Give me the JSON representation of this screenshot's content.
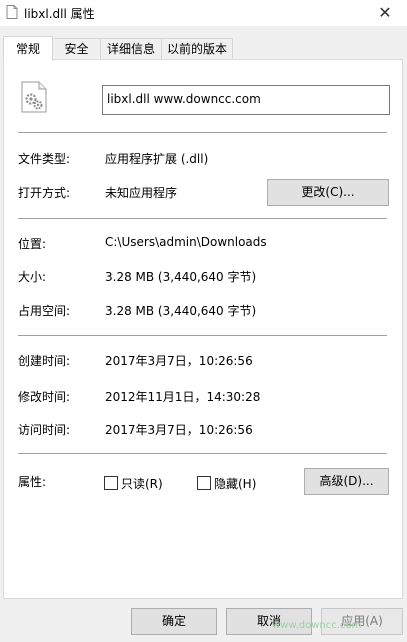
{
  "window": {
    "title": "libxl.dll 属性",
    "close_glyph": "✕"
  },
  "tabs": [
    {
      "label": "常规",
      "active": true
    },
    {
      "label": "安全"
    },
    {
      "label": "详细信息"
    },
    {
      "label": "以前的版本"
    }
  ],
  "file": {
    "name_field": "libxl.dll    www.downcc.com"
  },
  "general": {
    "type_label": "文件类型:",
    "type_value": "应用程序扩展 (.dll)",
    "open_label": "打开方式:",
    "open_value": "未知应用程序",
    "change_button": "更改(C)...",
    "location_label": "位置:",
    "location_value": "C:\\Users\\admin\\Downloads",
    "size_label": "大小:",
    "size_value": "3.28 MB (3,440,640 字节)",
    "disk_label": "占用空间:",
    "disk_value": "3.28 MB (3,440,640 字节)",
    "created_label": "创建时间:",
    "created_value": "2017年3月7日，10:26:56",
    "modified_label": "修改时间:",
    "modified_value": "2012年11月1日，14:30:28",
    "accessed_label": "访问时间:",
    "accessed_value": "2017年3月7日，10:26:56",
    "attrs_label": "属性:",
    "readonly_label": "只读(R)",
    "hidden_label": "隐藏(H)",
    "advanced_button": "高级(D)..."
  },
  "footer": {
    "ok": "确定",
    "cancel": "取消",
    "apply": "应用(A)"
  },
  "watermark": "www.downcc.com"
}
